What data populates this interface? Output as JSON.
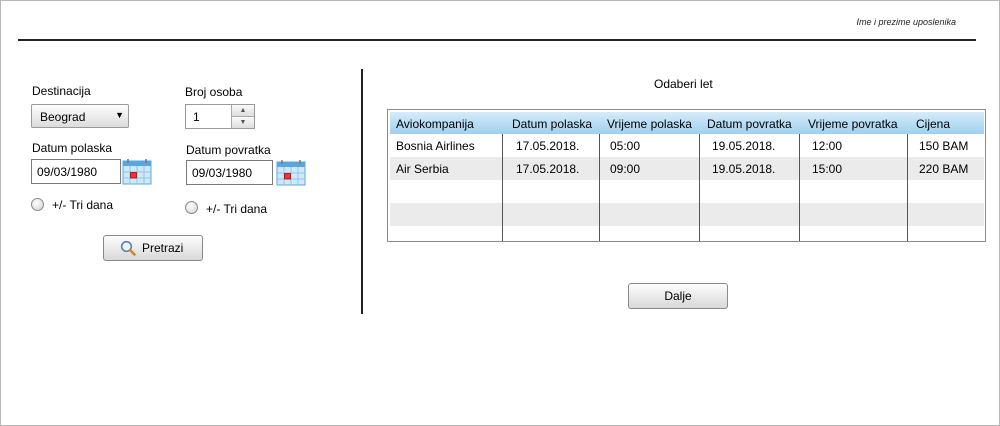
{
  "header": {
    "user_name": "Ime i prezime uposlenika"
  },
  "search": {
    "destination_label": "Destinacija",
    "destination_value": "Beograd",
    "persons_label": "Broj osoba",
    "persons_value": "1",
    "departure_label": "Datum polaska",
    "departure_value": "09/03/1980",
    "return_label": "Datum povratka",
    "return_value": "09/03/1980",
    "flex_label_departure": "+/- Tri dana",
    "flex_label_return": "+/- Tri dana",
    "search_button": "Pretrazi"
  },
  "results": {
    "title": "Odaberi let",
    "columns": [
      "Aviokompanija",
      "Datum polaska",
      "Vrijeme polaska",
      "Datum povratka",
      "Vrijeme povratka",
      "Cijena"
    ],
    "rows": [
      [
        "Bosnia Airlines",
        "17.05.2018.",
        "05:00",
        "19.05.2018.",
        "12:00",
        "150 BAM"
      ],
      [
        "Air Serbia",
        "17.05.2018.",
        "09:00",
        "19.05.2018.",
        "15:00",
        "220 BAM"
      ]
    ],
    "next_button": "Dalje"
  },
  "colors": {
    "header_gradient_top": "#d6ecfa",
    "header_gradient_bottom": "#9fd0f0",
    "alt_row": "#ebebeb"
  },
  "icons": {
    "calendar": "calendar-icon",
    "search": "magnifier-icon",
    "dropdown": "chevron-down-icon"
  }
}
